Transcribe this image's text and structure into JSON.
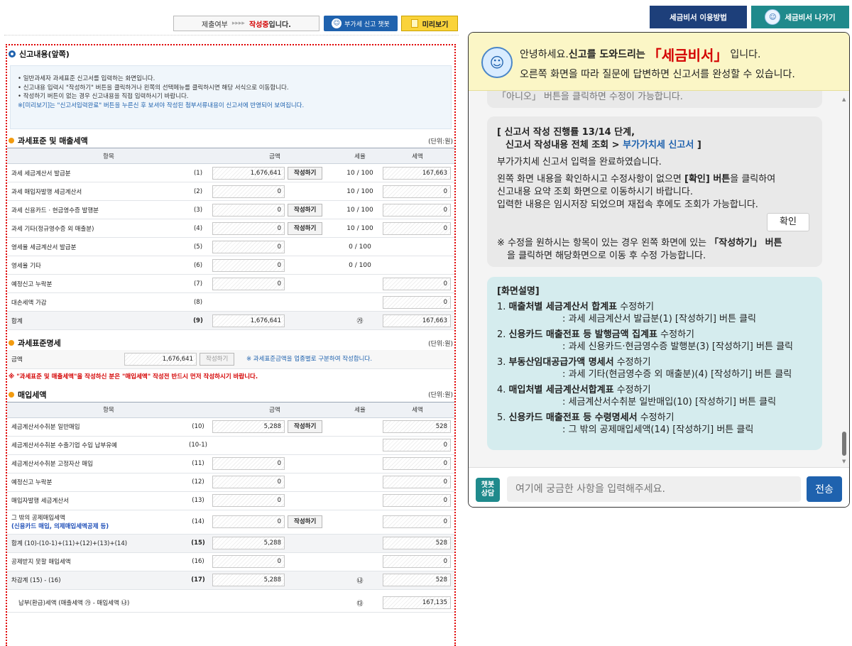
{
  "topbar": {
    "status_label": "제출여부",
    "status_arrows": "▸▸▸▸",
    "status_value_red": "작성중",
    "status_value_suffix": "입니다.",
    "chatbot_label": "부가세 신고 챗봇",
    "preview_label": "미리보기"
  },
  "section1": {
    "title": "신고내용(앞쪽)",
    "info": [
      "• 일반과세자 과세표준 신고서를 입력하는 화면입니다.",
      "• 신고내용 입력시 \"작성하기\" 버튼을 클릭하거나 왼쪽의 선택메뉴를 클릭하시면 해당 서식으로 이동합니다.",
      "• 작성하기 버튼이 없는 경우 신고내용을 직접 입력하시기 바랍니다.",
      "※[미리보기]는 \"신고서입력완료\" 버튼을 누른신 후 보셔야 작성된 첨부서류내용이 신고서에 반영되어 보여집니다."
    ]
  },
  "sales": {
    "title": "과세표준 및 매출세액",
    "unit": "(단위:원)",
    "headers": [
      "항목",
      "금액",
      "세율",
      "세액"
    ],
    "rows": [
      {
        "label": "과세 세금계산서 발급분",
        "no": "(1)",
        "amount": "1,676,641",
        "btn": "작성하기",
        "rate": "10 / 100",
        "tax": "167,663"
      },
      {
        "label": "과세 매입자발행 세금계산서",
        "no": "(2)",
        "amount": "0",
        "btn": "",
        "rate": "10 / 100",
        "tax": "0"
      },
      {
        "label": "과세 신용카드 · 현금영수증 발행분",
        "no": "(3)",
        "amount": "0",
        "btn": "작성하기",
        "rate": "10 / 100",
        "tax": "0"
      },
      {
        "label": "과세 기타(정규영수증 외 매출분)",
        "no": "(4)",
        "amount": "0",
        "btn": "작성하기",
        "rate": "10 / 100",
        "tax": "0"
      },
      {
        "label": "영세율 세금계산서 발급분",
        "no": "(5)",
        "amount": "0",
        "btn": "",
        "rate": "0 / 100",
        "tax": ""
      },
      {
        "label": "영세율 기타",
        "no": "(6)",
        "amount": "0",
        "btn": "",
        "rate": "0 / 100",
        "tax": ""
      },
      {
        "label": "예정신고 누락분",
        "no": "(7)",
        "amount": "0",
        "btn": "",
        "rate": "",
        "tax": "0"
      },
      {
        "label": "대손세액 가감",
        "no": "(8)",
        "amount": "",
        "btn": "",
        "rate": "",
        "tax": "0"
      }
    ],
    "total": {
      "label": "합계",
      "no": "(9)",
      "amount": "1,676,641",
      "rate": "㉮",
      "tax": "167,663"
    }
  },
  "detail": {
    "title": "과세표준명세",
    "unit": "(단위:원)",
    "label": "금액",
    "amount": "1,676,641",
    "btn": "작성하기",
    "note": "※ 과세표준금액을 업종별로 구분하여 작성합니다.",
    "warning": "※ \"과세표준 및 매출세액\"을 작성하신 분은 \"매입세액\" 작성전 반드시 먼저 작성하시기 바랍니다."
  },
  "purchase": {
    "title": "매입세액",
    "unit": "(단위:원)",
    "headers": [
      "항목",
      "금액",
      "세율",
      "세액"
    ],
    "rows": [
      {
        "label": "세금계산서수취분 일반매입",
        "label2": "",
        "no": "(10)",
        "amount": "5,288",
        "btn": "작성하기",
        "rate": "",
        "tax": "528",
        "sum": false
      },
      {
        "label": "세금계산서수취분 수출기업 수입 납부유예",
        "label2": "",
        "no": "(10-1)",
        "amount": "",
        "btn": "",
        "rate": "",
        "tax": "0",
        "sum": false
      },
      {
        "label": "세금계산서수취분 고정자산 매입",
        "label2": "",
        "no": "(11)",
        "amount": "0",
        "btn": "",
        "rate": "",
        "tax": "0",
        "sum": false
      },
      {
        "label": "예정신고 누락분",
        "label2": "",
        "no": "(12)",
        "amount": "0",
        "btn": "",
        "rate": "",
        "tax": "0",
        "sum": false
      },
      {
        "label": "매입자발행 세금계산서",
        "label2": "",
        "no": "(13)",
        "amount": "0",
        "btn": "",
        "rate": "",
        "tax": "0",
        "sum": false
      },
      {
        "label": "그 밖의 공제매입세액",
        "label2": "(신용카드 매입, 의제매입세액공제 등)",
        "no": "(14)",
        "amount": "0",
        "btn": "작성하기",
        "rate": "",
        "tax": "0",
        "sum": false
      },
      {
        "label": "합계 (10)-(10-1)+(11)+(12)+(13)+(14)",
        "label2": "",
        "no": "(15)",
        "amount": "5,288",
        "btn": "",
        "rate": "",
        "tax": "528",
        "sum": true
      },
      {
        "label": "공제받지 못할 매입세액",
        "label2": "",
        "no": "(16)",
        "amount": "0",
        "btn": "",
        "rate": "",
        "tax": "0",
        "sum": false
      },
      {
        "label": "차감계 (15) - (16)",
        "label2": "",
        "no": "(17)",
        "amount": "5,288",
        "btn": "",
        "rate": "㉯",
        "tax": "528",
        "sum": true
      }
    ]
  },
  "payable": {
    "label": "납부(환급)세액 (매출세액 ㉮ - 매입세액 ㉯)",
    "rate": "㉰",
    "tax": "167,135"
  },
  "right": {
    "guide_btn": "세금비서 이용방법",
    "exit_btn": "세금비서 나가기",
    "head_l1_a": "안녕하세요. ",
    "head_l1_b": "신고를 도와드리는",
    "head_l1_big": "「세금비서」",
    "head_l1_c": "입니다.",
    "head_l2": "오른쪽 화면을 따라 질문에 답변하면 신고서를 완성할 수 있습니다.",
    "msg1_tail": "「아니오」 버튼을 클릭하면 수정이 가능합니다.",
    "msg2_h1": "[ 신고서 작성 진행률 13/14 단계,",
    "msg2_h2a": "신고서 작성내용 전체 조회 > ",
    "msg2_h2b": "부가가치세 신고서",
    "msg2_h2c": " ]",
    "msg2_p1": "부가가치세 신고서 입력을 완료하였습니다.",
    "msg2_p2a": "왼쪽 화면 내용을 확인하시고 수정사항이 없으면 ",
    "msg2_p2b": "[확인] 버튼",
    "msg2_p2c": "을 클릭하여 신고내용 요약 조회 화면으로 이동하시기 바랍니다.",
    "msg2_p3": "입력한 내용은 임시저장 되었으며 재접속 후에도 조회가 가능합니다.",
    "ok_btn": "확인",
    "msg2_note_a": "※ 수정을 원하시는 항목이 있는 경우 왼쪽 화면에 있는 ",
    "msg2_note_b": "「작성하기」 버튼",
    "msg2_note_c": "을 클릭하면 해당화면으로 이동 후 수정 가능합니다.",
    "msg3_title": "[화면설명]",
    "msg3_items": [
      {
        "num": "1. ",
        "bold": "매출처별 세금계산서 합계표",
        "rest": " 수정하기",
        "sub": ": 과세 세금계산서 발급분(1) [작성하기] 버튼 클릭"
      },
      {
        "num": "2. ",
        "bold": "신용카드 매출전표 등 발행금액 집계표",
        "rest": " 수정하기",
        "sub": ": 과세 신용카드·현금영수증 발행분(3) [작성하기] 버튼 클릭"
      },
      {
        "num": "3. ",
        "bold": "부동산임대공급가액 명세서",
        "rest": " 수정하기",
        "sub": ": 과세 기타(현금영수증 외 매출분)(4) [작성하기] 버튼 클릭"
      },
      {
        "num": "4. ",
        "bold": "매입처별 세금계산서합계표",
        "rest": " 수정하기",
        "sub": ": 세금계산서수취분 일반매입(10) [작성하기] 버튼 클릭"
      },
      {
        "num": "5. ",
        "bold": "신용카드 매출전표 등 수령명세서",
        "rest": " 수정하기",
        "sub": ": 그 밖의 공제매입세액(14) [작성하기] 버튼 클릭"
      }
    ],
    "chatbot_badge": "챗봇\n상담",
    "input_placeholder": "여기에 궁금한 사항을 입력해주세요.",
    "send_btn": "전송"
  }
}
